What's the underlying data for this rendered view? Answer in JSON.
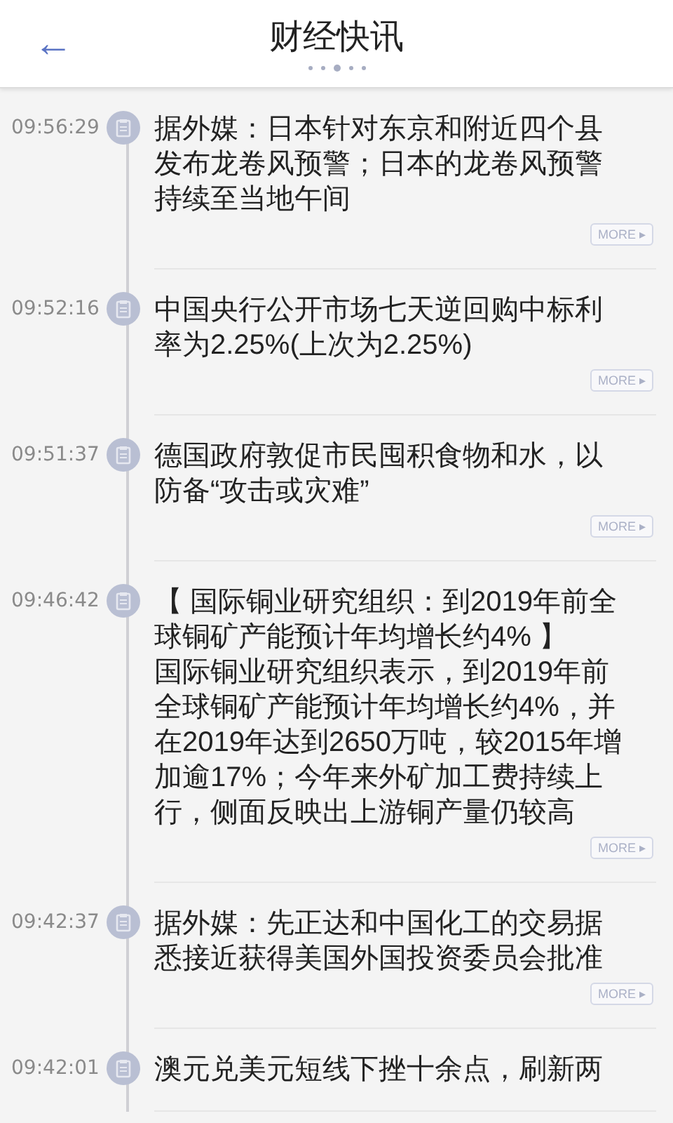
{
  "header": {
    "back": "←",
    "title": "财经快讯",
    "pager": [
      {
        "selected": false
      },
      {
        "selected": false
      },
      {
        "selected": true
      },
      {
        "selected": false
      },
      {
        "selected": false
      }
    ]
  },
  "news": [
    {
      "time": "09:56:29",
      "text": "据外媒：日本针对东京和附近四个县发布龙卷风预警；日本的龙卷风预警持续至当地午间",
      "more": "MORE ▸"
    },
    {
      "time": "09:52:16",
      "text": "中国央行公开市场七天逆回购中标利率为2.25%(上次为2.25%)",
      "more": "MORE ▸"
    },
    {
      "time": "09:51:37",
      "text": "德国政府敦促市民囤积食物和水，以防备“攻击或灾难”",
      "more": "MORE ▸"
    },
    {
      "time": "09:46:42",
      "headline": "【 国际铜业研究组织：到2019年前全球铜矿产能预计年均增长约4% 】",
      "text": "国际铜业研究组织表示，到2019年前全球铜矿产能预计年均增长约4%，并在2019年达到2650万吨，较2015年增加逾17%；今年来外矿加工费持续上行，侧面反映出上游铜产量仍较高",
      "more": "MORE ▸"
    },
    {
      "time": "09:42:37",
      "text": "据外媒：先正达和中国化工的交易据悉接近获得美国外国投资委员会批准",
      "more": "MORE ▸"
    },
    {
      "time": "09:42:01",
      "text": "澳元兑美元短线下挫十余点，刷新两"
    }
  ]
}
